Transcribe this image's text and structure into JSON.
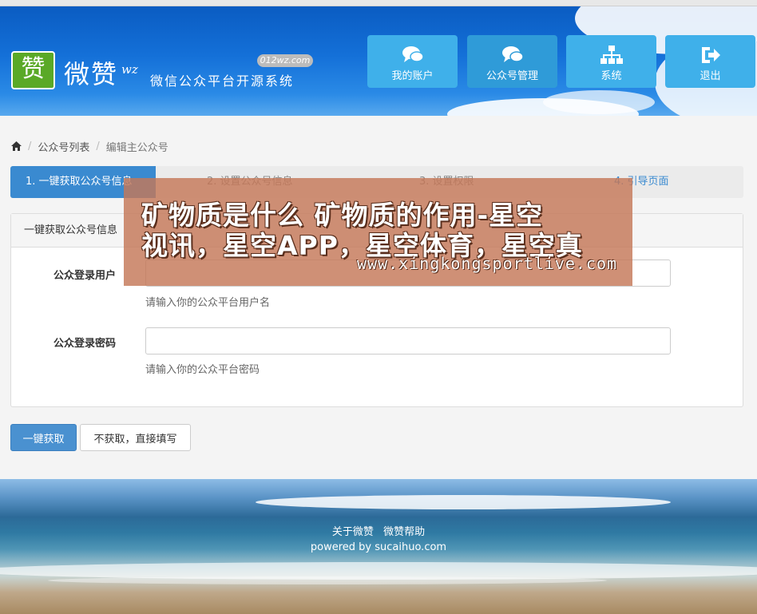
{
  "header": {
    "logo_char": "赞",
    "logo_name": "微赞",
    "logo_wz": "wz",
    "logo_site": "012wz.com",
    "logo_subtitle": "微信公众平台开源系统",
    "nav": [
      {
        "label": "我的账户",
        "icon": "chat-bubbles-icon"
      },
      {
        "label": "公众号管理",
        "icon": "chat-bubbles-icon"
      },
      {
        "label": "系统",
        "icon": "sitemap-icon"
      },
      {
        "label": "退出",
        "icon": "sign-out-icon"
      }
    ]
  },
  "breadcrumb": {
    "home_icon": "home-icon",
    "items": [
      "公众号列表",
      "编辑主公众号"
    ]
  },
  "steps": [
    "1. 一键获取公众号信息",
    "2. 设置公众号信息",
    "3. 设置权限",
    "4. 引导页面"
  ],
  "panel": {
    "title": "一键获取公众号信息",
    "fields": [
      {
        "label": "公众登录用户",
        "value": "",
        "help": "请输入你的公众平台用户名"
      },
      {
        "label": "公众登录密码",
        "value": "",
        "help": "请输入你的公众平台密码"
      }
    ]
  },
  "buttons": {
    "primary": "一键获取",
    "secondary": "不获取，直接填写"
  },
  "footer": {
    "links": [
      "关于微赞",
      "微赞帮助"
    ],
    "powered": "powered by sucaihuo.com"
  },
  "overlay": {
    "line1": "矿物质是什么 矿物质的作用-星空",
    "line2": "视讯，星空APP，星空体育，星空真",
    "url": "www.xingkongsportlive.com"
  },
  "colors": {
    "header_blue": "#1470d8",
    "nav_button": "#3fb0ea",
    "step_active": "#3a8ad0",
    "primary_button": "#4a91d0",
    "logo_green": "#5aa927",
    "overlay": "#c47858"
  }
}
